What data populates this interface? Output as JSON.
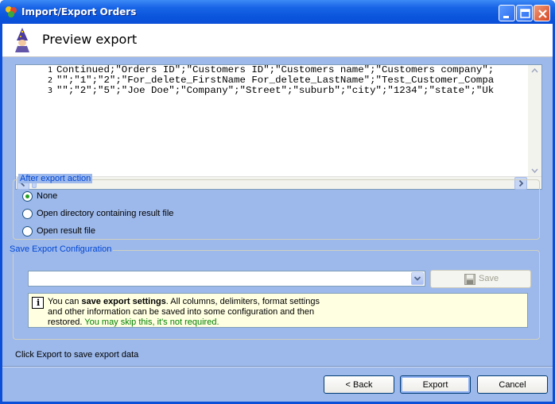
{
  "window": {
    "title": "Import/Export Orders"
  },
  "header": {
    "title": "Preview export"
  },
  "preview": {
    "line_numbers": [
      "1",
      "2",
      "3"
    ],
    "lines": [
      "Continued;\"Orders ID\";\"Customers ID\";\"Customers name\";\"Customers company\";",
      "\"\";\"1\";\"2\";\"For_delete_FirstName For_delete_LastName\";\"Test_Customer_Compa",
      "\"\";\"2\";\"5\";\"Joe Doe\";\"Company\";\"Street\";\"suburb\";\"city\";\"1234\";\"state\";\"Uk"
    ]
  },
  "after_export": {
    "label": "After export action",
    "options": [
      {
        "label": "None",
        "selected": true
      },
      {
        "label": "Open directory containing result file",
        "selected": false
      },
      {
        "label": "Open result file",
        "selected": false
      }
    ]
  },
  "save_config": {
    "label": "Save Export Configuration",
    "combo_value": "",
    "save_label": "Save",
    "info": {
      "prefix": "You can ",
      "bold": "save export settings",
      "rest1": ". All columns, delimiters, format settings",
      "line2": "and other information can be saved into some configuration and then",
      "line3_prefix": "restored. ",
      "line3_green": "You may skip this, it's not required."
    }
  },
  "status": {
    "text": "Click Export to save export data"
  },
  "buttons": {
    "back": "< Back",
    "export": "Export",
    "cancel": "Cancel"
  }
}
